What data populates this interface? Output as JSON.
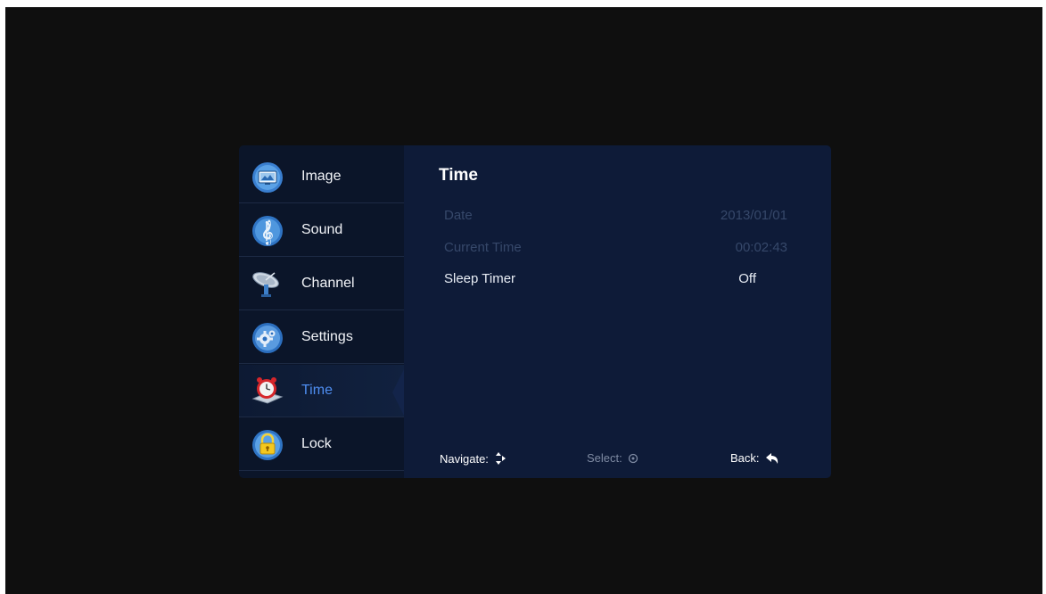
{
  "sidebar": {
    "items": [
      {
        "label": "Image",
        "icon": "image-icon"
      },
      {
        "label": "Sound",
        "icon": "sound-icon"
      },
      {
        "label": "Channel",
        "icon": "satellite-dish-icon"
      },
      {
        "label": "Settings",
        "icon": "settings-gear-icon"
      },
      {
        "label": "Time",
        "icon": "alarm-clock-icon",
        "active": true
      },
      {
        "label": "Lock",
        "icon": "padlock-icon"
      }
    ]
  },
  "main": {
    "title": "Time",
    "rows": [
      {
        "label": "Date",
        "value": "2013/01/01",
        "enabled": false
      },
      {
        "label": "Current Time",
        "value": "00:02:43",
        "enabled": false
      },
      {
        "label": "Sleep Timer",
        "value": "Off",
        "enabled": true
      }
    ]
  },
  "footer": {
    "navigate": "Navigate:",
    "select": "Select:",
    "back": "Back:"
  },
  "colors": {
    "active_accent": "#4e8df0",
    "panel_bg": "#0e1b38",
    "sidebar_bg": "#0b1529",
    "screen_bg": "#0f0f0f"
  }
}
